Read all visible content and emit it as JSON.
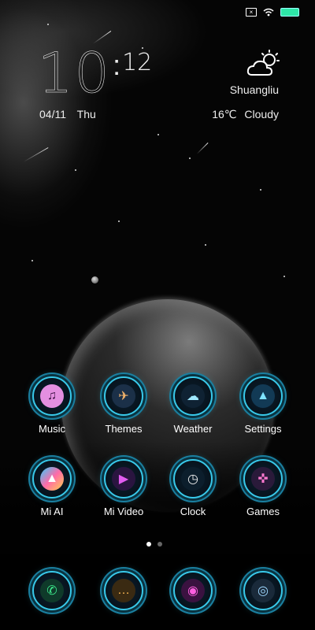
{
  "status": {
    "sim_label": "×",
    "wifi": "wifi-icon",
    "battery": "battery-icon"
  },
  "clock": {
    "hour": "10",
    "minute": "12",
    "date": "04/11",
    "weekday": "Thu"
  },
  "weather": {
    "city": "Shuangliu",
    "temperature": "16℃",
    "condition": "Cloudy",
    "icon": "partly-cloudy-icon"
  },
  "apps_row1": [
    {
      "label": "Music",
      "icon": "music-icon"
    },
    {
      "label": "Themes",
      "icon": "themes-icon"
    },
    {
      "label": "Weather",
      "icon": "weather-icon"
    },
    {
      "label": "Settings",
      "icon": "settings-icon"
    }
  ],
  "apps_row2": [
    {
      "label": "Mi AI",
      "icon": "mi-ai-icon"
    },
    {
      "label": "Mi Video",
      "icon": "video-play-icon"
    },
    {
      "label": "Clock",
      "icon": "clock-icon"
    },
    {
      "label": "Games",
      "icon": "gamepad-icon"
    }
  ],
  "dock": [
    {
      "icon": "phone-icon"
    },
    {
      "icon": "messages-icon"
    },
    {
      "icon": "browser-icon"
    },
    {
      "icon": "camera-icon"
    }
  ],
  "page_indicator": {
    "pages": 2,
    "current": 1
  },
  "colors": {
    "accent": "#38c9ea",
    "battery": "#2ee6a8",
    "background": "#050505"
  }
}
